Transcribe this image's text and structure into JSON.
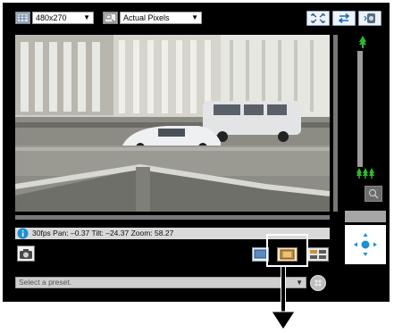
{
  "toolbar": {
    "resolution_value": "480x270",
    "display_mode_value": "Actual Pixels",
    "resolution_icon": "resolution-icon",
    "display_mode_icon": "actual-pixels-icon",
    "fullscreen_icon": "fullscreen-icon",
    "swap_icon": "swap-icon",
    "volume_icon": "volume-icon"
  },
  "status": {
    "text": "30fps Pan: –0.37 Tilt: –24.37 Zoom: 58.27"
  },
  "preset": {
    "placeholder": "Select a preset."
  },
  "colors": {
    "accent": "#1a8fd1",
    "panel": "#000000",
    "tree_green": "#2fb82f"
  }
}
